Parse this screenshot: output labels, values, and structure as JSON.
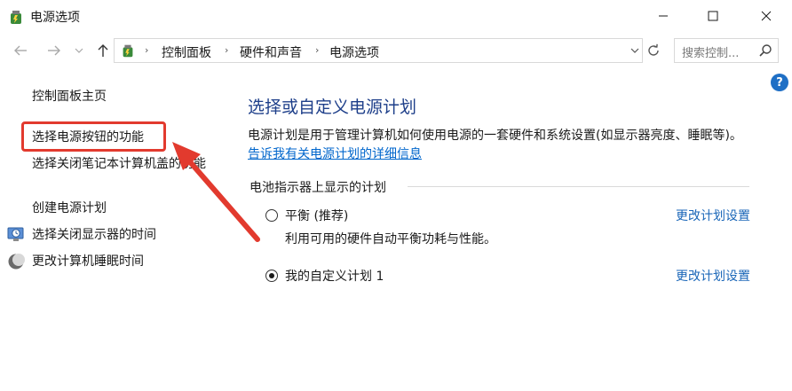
{
  "window": {
    "title": "电源选项",
    "controls": {
      "minimize_icon": "minimize-icon",
      "maximize_icon": "maximize-icon",
      "close_icon": "close-icon"
    }
  },
  "nav": {
    "back_icon": "back-arrow-icon",
    "forward_icon": "forward-arrow-icon",
    "recent_icon": "chevron-down-icon",
    "up_icon": "up-arrow-icon"
  },
  "address": {
    "breadcrumbs": [
      "控制面板",
      "硬件和声音",
      "电源选项"
    ],
    "separator": "›"
  },
  "search": {
    "placeholder": "搜索控制..."
  },
  "left": {
    "home": "控制面板主页",
    "links": [
      {
        "label": "选择电源按钮的功能"
      },
      {
        "label": "选择关闭笔记本计算机盖的功能"
      },
      {
        "label": "创建电源计划"
      },
      {
        "label": "选择关闭显示器的时间"
      },
      {
        "label": "更改计算机睡眠时间"
      }
    ]
  },
  "main": {
    "title": "选择或自定义电源计划",
    "description": "电源计划是用于管理计算机如何使用电源的一套硬件和系统设置(如显示器亮度、睡眠等)。",
    "more_link": "告诉我有关电源计划的详细信息",
    "section_label": "电池指示器上显示的计划",
    "plans": [
      {
        "name": "平衡 (推荐)",
        "description": "利用可用的硬件自动平衡功耗与性能。",
        "selected": false,
        "change_link": "更改计划设置"
      },
      {
        "name": "我的自定义计划 1",
        "description": "",
        "selected": true,
        "change_link": "更改计划设置"
      }
    ]
  },
  "help": {
    "label": "?"
  },
  "annotation": {
    "highlight_color": "#e23a2e"
  }
}
